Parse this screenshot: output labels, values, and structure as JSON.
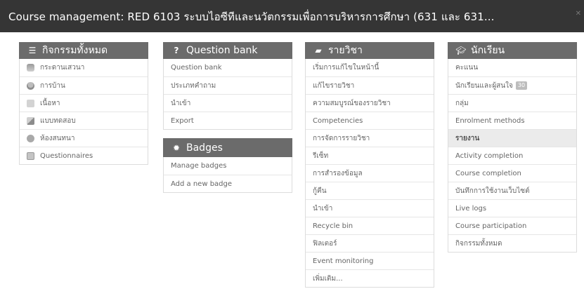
{
  "window": {
    "title": "Course management: RED 6103 ระบบไอซีทีและนวัตกรรมเพื่อการบริหารการศึกษา (631 และ 631..."
  },
  "blocks": {
    "activities": {
      "title": "กิจกรรมทั้งหมด",
      "icon": "list-icon",
      "items": [
        {
          "label": "กระดานเสวนา",
          "icon": "forum-icon"
        },
        {
          "label": "การบ้าน",
          "icon": "assignment-icon"
        },
        {
          "label": "เนื้อหา",
          "icon": "page-icon"
        },
        {
          "label": "แบบทดสอบ",
          "icon": "quiz-icon"
        },
        {
          "label": "ห้องสนทนา",
          "icon": "chat-icon"
        },
        {
          "label": "Questionnaires",
          "icon": "questionnaire-icon"
        }
      ]
    },
    "question_bank": {
      "title": "Question bank",
      "icon": "question-icon",
      "items": [
        {
          "label": "Question bank"
        },
        {
          "label": "ประเภทคำถาม"
        },
        {
          "label": "นำเข้า"
        },
        {
          "label": "Export"
        }
      ]
    },
    "badges": {
      "title": "Badges",
      "icon": "badge-icon",
      "items": [
        {
          "label": "Manage badges"
        },
        {
          "label": "Add a new badge"
        }
      ]
    },
    "course": {
      "title": "รายวิชา",
      "icon": "book-icon",
      "items": [
        {
          "label": "เริ่มการแก้ไขในหน้านี้"
        },
        {
          "label": "แก้ไขรายวิชา"
        },
        {
          "label": "ความสมบูรณ์ของรายวิชา"
        },
        {
          "label": "Competencies"
        },
        {
          "label": "การจัดการรายวิชา"
        },
        {
          "label": "รีเซ็ท"
        },
        {
          "label": "การสำรองข้อมูล"
        },
        {
          "label": "กู้คืน"
        },
        {
          "label": "นำเข้า"
        },
        {
          "label": "Recycle bin"
        },
        {
          "label": "ฟิลเตอร์"
        },
        {
          "label": "Event monitoring"
        },
        {
          "label": "เพิ่มเติม..."
        }
      ]
    },
    "students": {
      "title": "นักเรียน",
      "icon": "graduation-cap-icon",
      "items": [
        {
          "label": "คะแนน"
        },
        {
          "label": "นักเรียนและผู้สนใจ",
          "badge": "30"
        },
        {
          "label": "กลุ่ม"
        },
        {
          "label": "Enrolment methods"
        },
        {
          "label": "รายงาน",
          "active": true
        },
        {
          "label": "Activity completion"
        },
        {
          "label": "Course completion"
        },
        {
          "label": "บันทึกการใช้งานเว็บไซต์"
        },
        {
          "label": "Live logs"
        },
        {
          "label": "Course participation"
        },
        {
          "label": "กิจกรรมทั้งหมด"
        }
      ]
    }
  }
}
